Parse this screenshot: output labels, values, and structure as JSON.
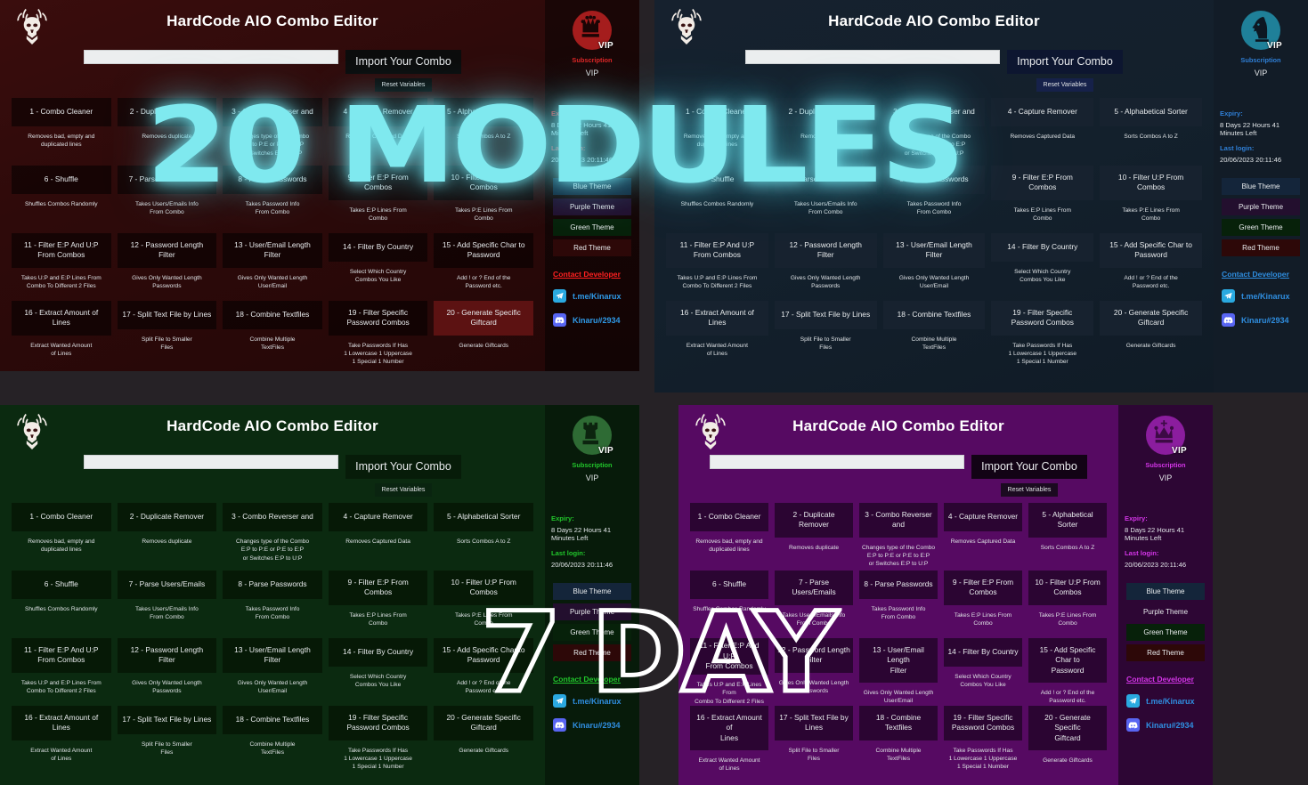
{
  "app": {
    "title": "HardCode AIO Combo Editor",
    "logo_icon": "deer-skull-icon"
  },
  "toolbar": {
    "combo_input_value": "",
    "combo_input_placeholder": "",
    "import_label": "Import Your Combo",
    "reset_label": "Reset Variables"
  },
  "sidebar": {
    "vip_badge_text": "VIP",
    "subscription_label": "Subscription",
    "subscription_value": "VIP",
    "expiry_label": "Expiry:",
    "expiry_value": "8 Days 22 Hours 41 Minutes Left",
    "last_login_label": "Last login:",
    "last_login_value": "20/06/2023 20:11:46",
    "themes": [
      {
        "label": "Blue Theme",
        "key": "blue",
        "color": "#14253a"
      },
      {
        "label": "Purple Theme",
        "key": "purple",
        "color": "#230f2e"
      },
      {
        "label": "Green Theme",
        "key": "green",
        "color": "#07210a"
      },
      {
        "label": "Red Theme",
        "key": "red",
        "color": "#2d0808"
      }
    ],
    "contact_label": "Contact Developer",
    "telegram": "t.me/Kinarux",
    "discord": "Kinaru#2934"
  },
  "modules": [
    {
      "title": "1 - Combo Cleaner",
      "desc": "Removes bad, empty and\nduplicated lines"
    },
    {
      "title": "2 - Duplicate Remover",
      "desc": "Removes duplicate"
    },
    {
      "title": "3 - Combo Reverser and",
      "desc": "Changes type of the Combo\nE:P to P:E or P:E to E:P\nor Switches E:P to U:P"
    },
    {
      "title": "4 - Capture Remover",
      "desc": "Removes Captured Data"
    },
    {
      "title": "5 - Alphabetical Sorter",
      "desc": "Sorts Combos A to Z"
    },
    {
      "title": "6 - Shuffle",
      "desc": "Shuffles Combos Randomly"
    },
    {
      "title": "7 - Parse Users/Emails",
      "desc": "Takes Users/Emails Info\nFrom Combo"
    },
    {
      "title": "8 - Parse Passwords",
      "desc": "Takes Password Info\nFrom Combo"
    },
    {
      "title": "9 - Filter E:P From\nCombos",
      "desc": "Takes E:P Lines From\nCombo"
    },
    {
      "title": "10 - Filter U:P From\nCombos",
      "desc": "Takes P:E Lines From\nCombo"
    },
    {
      "title": "11 - Filter E:P And U:P\nFrom Combos",
      "desc": "Takes U:P and E:P Lines From\nCombo To Different 2 Files"
    },
    {
      "title": "12 - Password Length\nFilter",
      "desc": "Gives Only Wanted Length\nPasswords"
    },
    {
      "title": "13 - User/Email Length\nFilter",
      "desc": "Gives Only Wanted Length\nUser/Email"
    },
    {
      "title": "14 - Filter By Country",
      "desc": "Select Which Country\nCombos You Like"
    },
    {
      "title": "15 - Add Specific Char to\nPassword",
      "desc": "Add ! or ? End of the\nPassword etc."
    },
    {
      "title": "16 - Extract Amount of\nLines",
      "desc": "Extract Wanted Amount\nof Lines"
    },
    {
      "title": "17 - Split Text File by Lines",
      "desc": "Split File to Smaller\nFiles"
    },
    {
      "title": "18 - Combine Textfiles",
      "desc": "Combine Multiple\nTextFiles"
    },
    {
      "title": "19 - Filter Specific\nPassword Combos",
      "desc": "Take Passwords If Has\n1 Lowercase 1 Uppercase\n1 Special 1 Number"
    },
    {
      "title": "20 - Generate Specific\nGiftcard",
      "desc": "Generate Giftcards"
    }
  ],
  "panels": [
    {
      "id": "red",
      "theme_name": "Red Theme",
      "vip_icon": "chess-queen-crown-icon",
      "accent": "#e02525"
    },
    {
      "id": "blue",
      "theme_name": "Blue Theme",
      "vip_icon": "chess-knight-icon",
      "accent": "#2f7fd6"
    },
    {
      "id": "green",
      "theme_name": "Green Theme",
      "vip_icon": "chess-rook-icon",
      "accent": "#21c62b"
    },
    {
      "id": "purple",
      "theme_name": "Purple Theme",
      "vip_icon": "chess-king-icon",
      "accent": "#d435e8"
    }
  ],
  "overlays": {
    "modules_text": "20 MODULES",
    "trial_text": "7 DAY",
    "modules_color": "#7fe9ef",
    "trial_color": "#ffffff"
  }
}
